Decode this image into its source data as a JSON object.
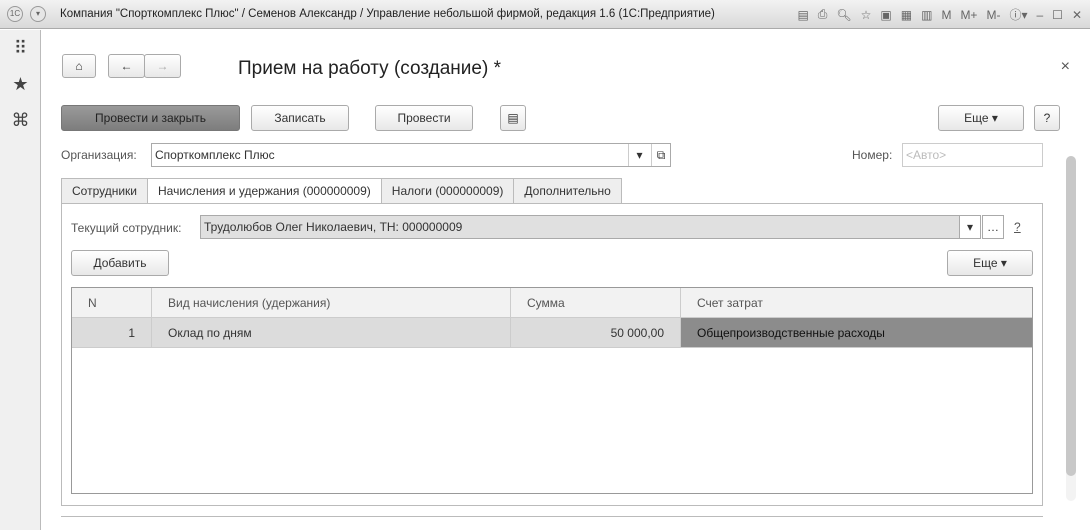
{
  "window": {
    "title": "Компания \"Спорткомплекс Плюс\" / Семенов Александр / Управление небольшой фирмой, редакция 1.6  (1С:Предприятие)",
    "m": "M",
    "mplus": "M+",
    "mminus": "M-"
  },
  "form": {
    "title": "Прием на работу (создание) *",
    "post_close": "Провести и закрыть",
    "save": "Записать",
    "post": "Провести",
    "more": "Еще",
    "help": "?",
    "close": "×"
  },
  "org": {
    "label": "Организация:",
    "value": "Спорткомплекс Плюс"
  },
  "number": {
    "label": "Номер:",
    "placeholder": "<Авто>"
  },
  "tabs": [
    "Сотрудники",
    "Начисления и удержания (000000009)",
    "Налоги (000000009)",
    "Дополнительно"
  ],
  "employee": {
    "label": "Текущий сотрудник:",
    "value": "Трудолюбов Олег Николаевич, ТН: 000000009",
    "help": "?"
  },
  "table": {
    "add": "Добавить",
    "more": "Еще",
    "columns": [
      "N",
      "Вид начисления (удержания)",
      "Сумма",
      "Счет затрат"
    ],
    "rows": [
      {
        "n": "1",
        "type": "Оклад по дням",
        "sum": "50 000,00",
        "account": "Общепроизводственные расходы"
      }
    ]
  }
}
